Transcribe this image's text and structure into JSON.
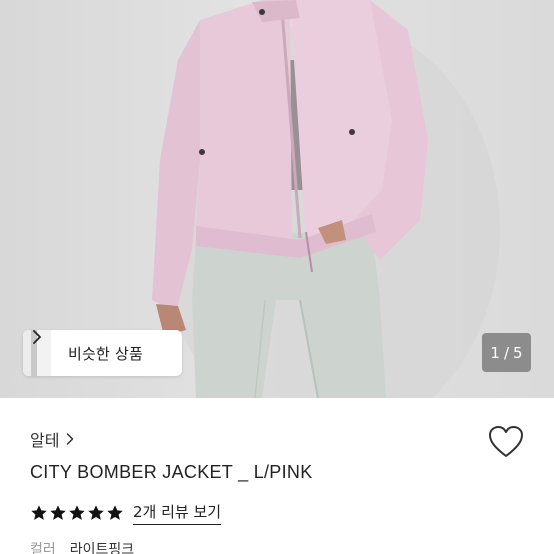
{
  "gallery": {
    "similar_label": "비슷한 상품",
    "current_page": "1",
    "separator": "/",
    "total_pages": "5"
  },
  "product": {
    "brand": "알테",
    "title": "CITY BOMBER JACKET _ L/PINK",
    "rating_stars": 5,
    "review_link": "2개 리뷰 보기",
    "specs": [
      {
        "key": "컬러",
        "value": "라이트핑크"
      }
    ]
  },
  "icons": {
    "brand_chevron": "chevron-right-icon",
    "similar_chevron": "chevron-right-icon",
    "wishlist": "heart-outline-icon",
    "star": "star-filled-icon"
  },
  "colors": {
    "jacket": "#e8c9d9",
    "pants": "#cdd4cf",
    "background": "#dddddd",
    "star": "#111111",
    "counter_bg": "#6e6e6e"
  }
}
